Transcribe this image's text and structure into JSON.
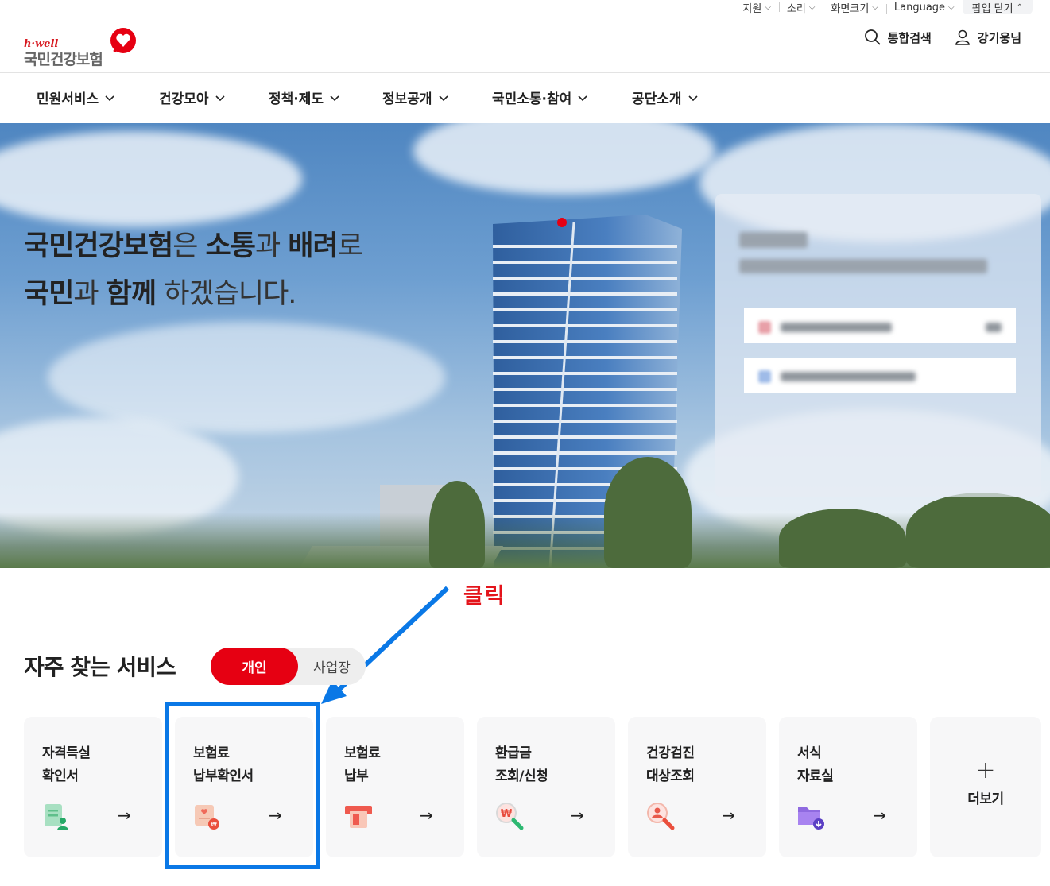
{
  "utility": {
    "items": [
      {
        "label": "지원"
      },
      {
        "label": "소리"
      },
      {
        "label": "화면크기"
      },
      {
        "label": "Language"
      },
      {
        "label": "팝업 닫기"
      }
    ]
  },
  "header": {
    "logo_tagline": "h·well",
    "logo_name": "국민건강보험",
    "search_label": "통합검색",
    "user_label": "강기웅님"
  },
  "nav": {
    "items": [
      {
        "label": "민원서비스"
      },
      {
        "label": "건강모아"
      },
      {
        "label": "정책·제도"
      },
      {
        "label": "정보공개"
      },
      {
        "label": "국민소통·참여"
      },
      {
        "label": "공단소개"
      }
    ]
  },
  "hero": {
    "line1": {
      "w1": "국민건강보험",
      "w2": "은 ",
      "w3": "소통",
      "w4": "과 ",
      "w5": "배려",
      "w6": "로"
    },
    "line2": {
      "w1": "국민",
      "w2": "과 ",
      "w3": "함께",
      "w4": " 하겠습니다."
    }
  },
  "annotation": {
    "click_label": "클릭",
    "color": "#0a78e6"
  },
  "services": {
    "title": "자주 찾는 서비스",
    "tabs": {
      "personal": "개인",
      "business": "사업장"
    },
    "cards": [
      {
        "line1": "자격득실",
        "line2": "확인서",
        "icon": "certificate-icon"
      },
      {
        "line1": "보험료",
        "line2": "납부확인서",
        "icon": "payment-confirm-icon"
      },
      {
        "line1": "보험료",
        "line2": "납부",
        "icon": "card-payment-icon"
      },
      {
        "line1": "환급금",
        "line2": "조회/신청",
        "icon": "refund-search-icon"
      },
      {
        "line1": "건강검진",
        "line2": "대상조회",
        "icon": "checkup-search-icon"
      },
      {
        "line1": "서식",
        "line2": "자료실",
        "icon": "folder-download-icon"
      }
    ],
    "more_label": "더보기",
    "arrow_glyph": "→"
  },
  "colors": {
    "brand_red": "#e60012",
    "highlight_blue": "#0a78e6"
  }
}
